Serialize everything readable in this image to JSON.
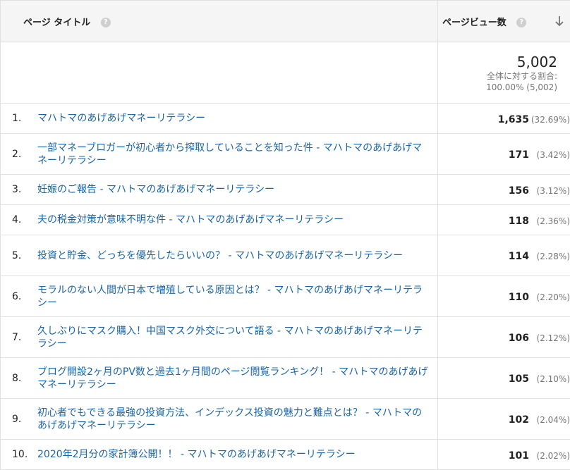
{
  "header": {
    "title_col": "ページ タイトル",
    "value_col": "ページビュー数",
    "help_icon": "question-circle-icon",
    "sort_icon": "arrow-down-icon"
  },
  "summary": {
    "total": "5,002",
    "pct_label": "全体に対する割合:",
    "pct_value": "100.00% (5,002)"
  },
  "rows": [
    {
      "rank": "1.",
      "title": "マハトマのあげあげマネーリテラシー",
      "views": "1,635",
      "pct": "(32.69%)"
    },
    {
      "rank": "2.",
      "title": "一部マネーブロガーが初心者から搾取していることを知った件 - マハトマのあげあげマネーリテラシー",
      "views": "171",
      "pct": "(3.42%)"
    },
    {
      "rank": "3.",
      "title": "妊娠のご報告 - マハトマのあげあげマネーリテラシー",
      "views": "156",
      "pct": "(3.12%)"
    },
    {
      "rank": "4.",
      "title": "夫の税金対策が意味不明な件 - マハトマのあげあげマネーリテラシー",
      "views": "118",
      "pct": "(2.36%)"
    },
    {
      "rank": "5.",
      "title": "投資と貯金、どっちを優先したらいいの？ - マハトマのあげあげマネーリテラシー",
      "views": "114",
      "pct": "(2.28%)"
    },
    {
      "rank": "6.",
      "title": "モラルのない人間が日本で増殖している原因とは？ - マハトマのあげあげマネーリテラシー",
      "views": "110",
      "pct": "(2.20%)"
    },
    {
      "rank": "7.",
      "title": "久しぶりにマスク購入！中国マスク外交について語る - マハトマのあげあげマネーリテラシー",
      "views": "106",
      "pct": "(2.12%)"
    },
    {
      "rank": "8.",
      "title": "ブログ開設2ヶ月のPV数と過去1ヶ月間のページ閲覧ランキング！ - マハトマのあげあげマネーリテラシー",
      "views": "105",
      "pct": "(2.10%)"
    },
    {
      "rank": "9.",
      "title": "初心者でもできる最強の投資方法、インデックス投資の魅力と難点とは？ - マハトマのあげあげマネーリテラシー",
      "views": "102",
      "pct": "(2.04%)"
    },
    {
      "rank": "10.",
      "title": "2020年2月分の家計簿公開！！ - マハトマのあげあげマネーリテラシー",
      "views": "101",
      "pct": "(2.02%)"
    }
  ]
}
